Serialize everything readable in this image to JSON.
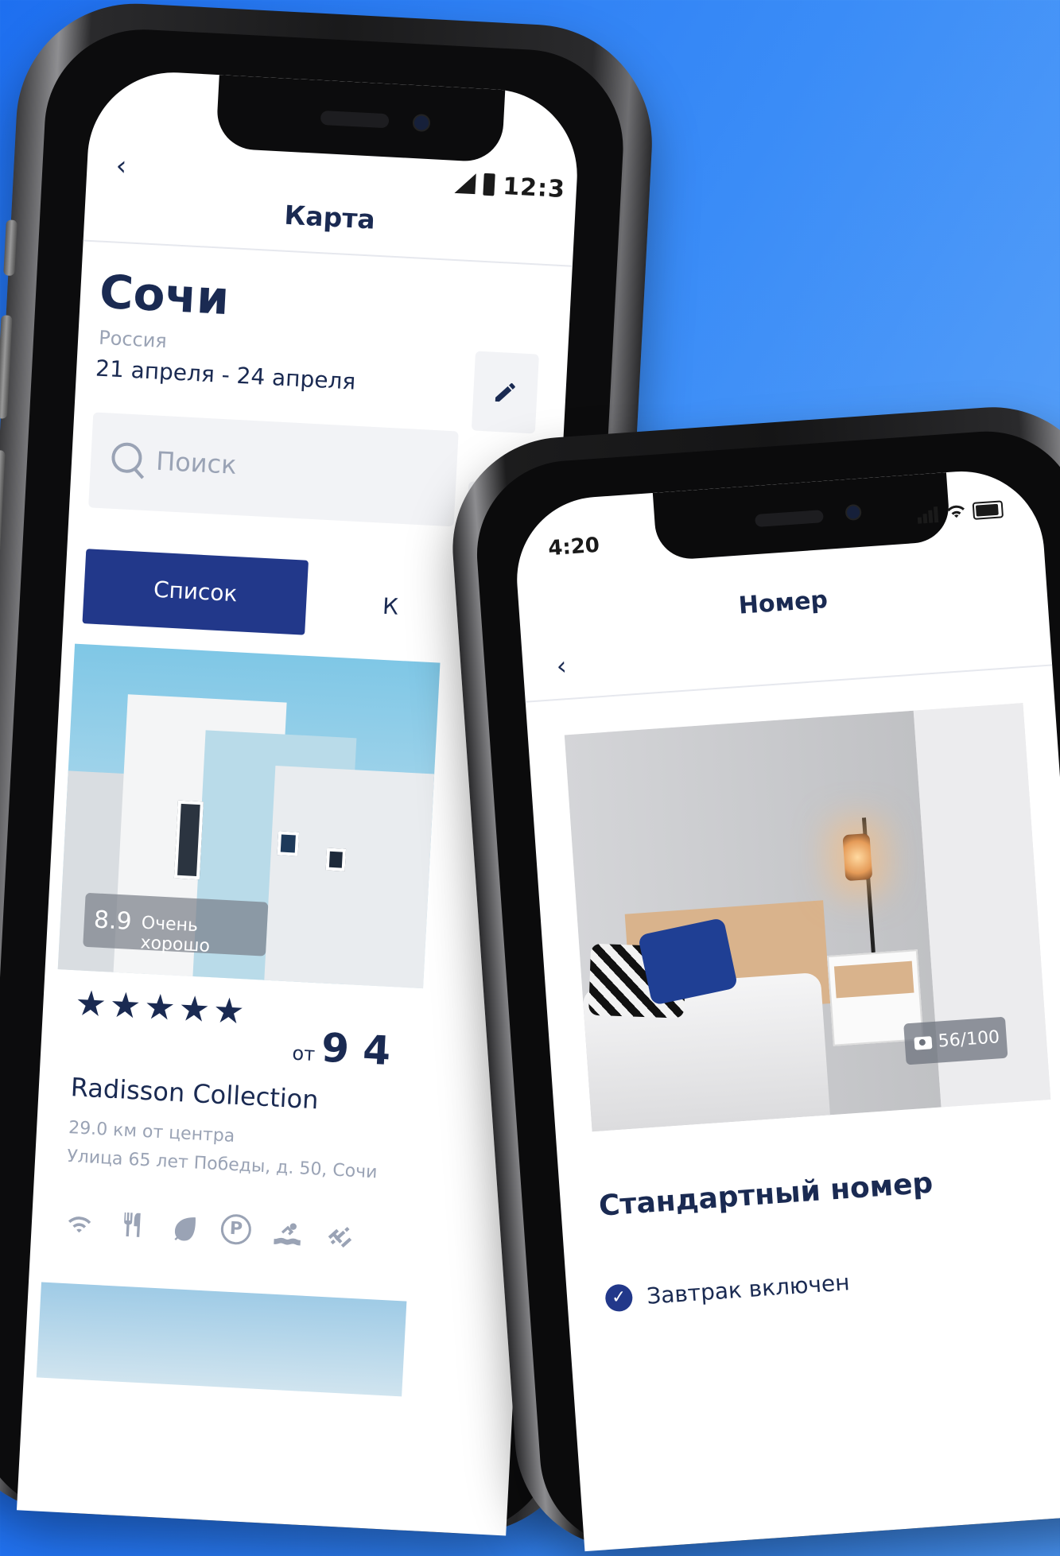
{
  "list_screen": {
    "status_time": "12:3",
    "header_title": "Карта",
    "city": "Сочи",
    "country": "Россия",
    "dates": "21 апреля - 24 апреля",
    "search_placeholder": "Поиск",
    "tab_list": "Список",
    "tab_map": "К",
    "hotel": {
      "rating": "8.9",
      "rating_text": "Очень хорошо",
      "stars": "★★★★★",
      "price_prefix": "от",
      "price_value": "9 4",
      "name": "Radisson Collection",
      "distance": "29.0 км от центра",
      "address": "Улица 65 лет Победы, д. 50, Сочи"
    }
  },
  "room_screen": {
    "status_time": "4:20",
    "header_title": "Номер",
    "photo_count": "56/100",
    "room_name": "Стандартный номер",
    "breakfast": "Завтрак включен"
  },
  "icons": {
    "back": "‹",
    "edit": "pencil-icon",
    "filter": "filter-icon",
    "wifi": "wifi-icon",
    "restaurant": "fork-knife-icon",
    "eco": "leaf-icon",
    "parking": "P",
    "pool": "swim-icon",
    "gym": "dumbbell-icon"
  },
  "colors": {
    "background": "#1e6ff0",
    "primary": "#22388a",
    "text": "#1a2a52",
    "muted": "#9aa3b5",
    "notification_dot": "#f04458"
  }
}
